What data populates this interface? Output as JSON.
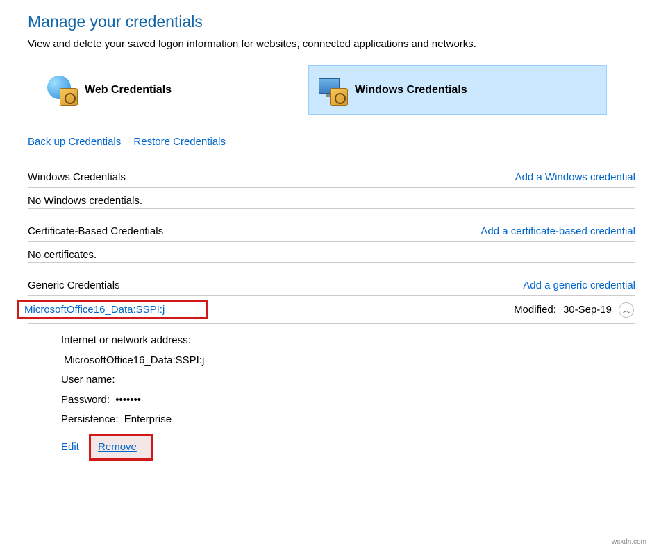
{
  "header": {
    "title": "Manage your credentials",
    "description": "View and delete your saved logon information for websites, connected applications and networks."
  },
  "categories": {
    "web": "Web Credentials",
    "windows": "Windows Credentials"
  },
  "links": {
    "backup": "Back up Credentials",
    "restore": "Restore Credentials"
  },
  "sections": {
    "windows": {
      "title": "Windows Credentials",
      "addLabel": "Add a Windows credential",
      "empty": "No Windows credentials."
    },
    "certificate": {
      "title": "Certificate-Based Credentials",
      "addLabel": "Add a certificate-based credential",
      "empty": "No certificates."
    },
    "generic": {
      "title": "Generic Credentials",
      "addLabel": "Add a generic credential"
    }
  },
  "credential": {
    "name": "MicrosoftOffice16_Data:SSPI:j",
    "modifiedLabel": "Modified:",
    "modifiedValue": "30-Sep-19",
    "details": {
      "addressLabel": "Internet or network address:",
      "addressValue": "MicrosoftOffice16_Data:SSPI:j",
      "usernameLabel": "User name:",
      "usernameValue": "",
      "passwordLabel": "Password:",
      "passwordValue": "•••••••",
      "persistenceLabel": "Persistence:",
      "persistenceValue": "Enterprise"
    },
    "actions": {
      "edit": "Edit",
      "remove": "Remove"
    }
  },
  "watermark": "wsxdn.com"
}
